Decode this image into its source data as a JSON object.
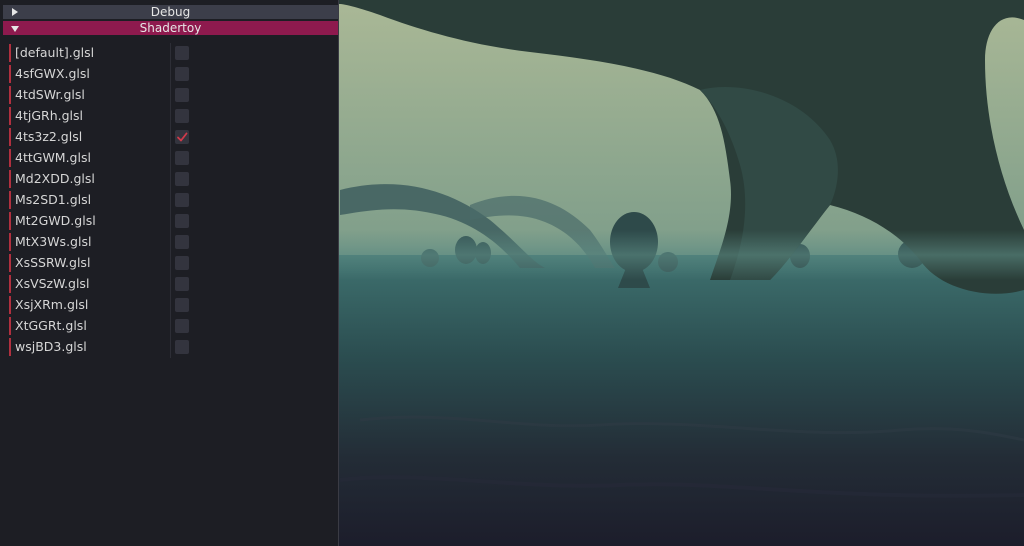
{
  "panel": {
    "debug_header": "Debug",
    "shadertoy_header": "Shadertoy",
    "items": [
      {
        "label": "[default].glsl",
        "checked": false
      },
      {
        "label": "4sfGWX.glsl",
        "checked": false
      },
      {
        "label": "4tdSWr.glsl",
        "checked": false
      },
      {
        "label": "4tjGRh.glsl",
        "checked": false
      },
      {
        "label": "4ts3z2.glsl",
        "checked": true
      },
      {
        "label": "4ttGWM.glsl",
        "checked": false
      },
      {
        "label": "Md2XDD.glsl",
        "checked": false
      },
      {
        "label": "Ms2SD1.glsl",
        "checked": false
      },
      {
        "label": "Mt2GWD.glsl",
        "checked": false
      },
      {
        "label": "MtX3Ws.glsl",
        "checked": false
      },
      {
        "label": "XsSSRW.glsl",
        "checked": false
      },
      {
        "label": "XsVSzW.glsl",
        "checked": false
      },
      {
        "label": "XsjXRm.glsl",
        "checked": false
      },
      {
        "label": "XtGGRt.glsl",
        "checked": false
      },
      {
        "label": "wsjBD3.glsl",
        "checked": false
      }
    ]
  },
  "colors": {
    "header_active": "#8e1a4e",
    "header_inactive": "#3c3e4a",
    "checkmark": "#d03a4a"
  }
}
